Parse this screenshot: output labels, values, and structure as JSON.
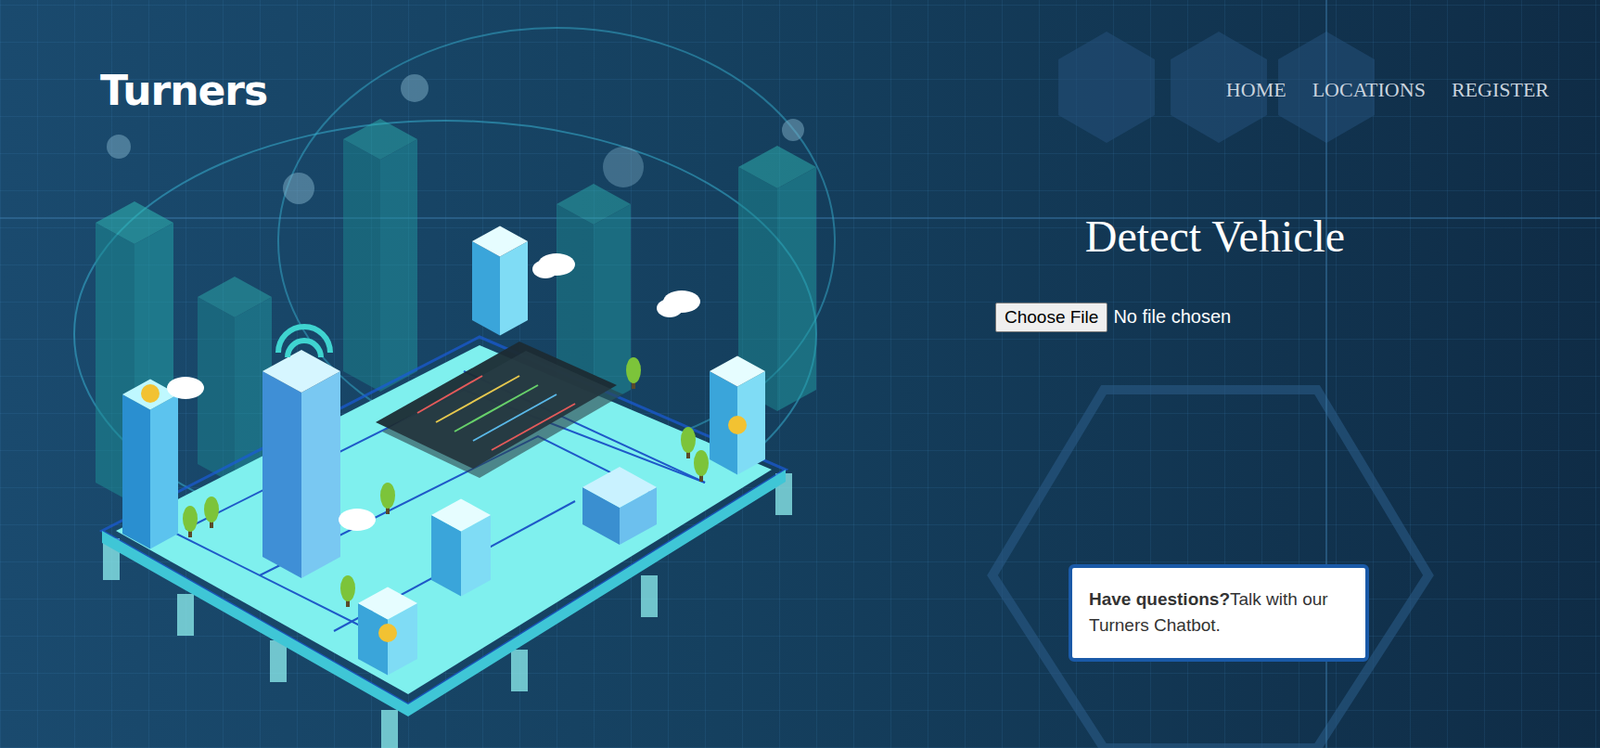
{
  "brand": "Turners",
  "nav": [
    {
      "label": "HOME"
    },
    {
      "label": "LOCATIONS"
    },
    {
      "label": "REGISTER"
    }
  ],
  "detect": {
    "title": "Detect Vehicle",
    "file_button": "Choose File",
    "file_status": "No file chosen"
  },
  "chatbot": {
    "lead": "Have questions?",
    "text": "Talk with our Turners Chatbot."
  }
}
